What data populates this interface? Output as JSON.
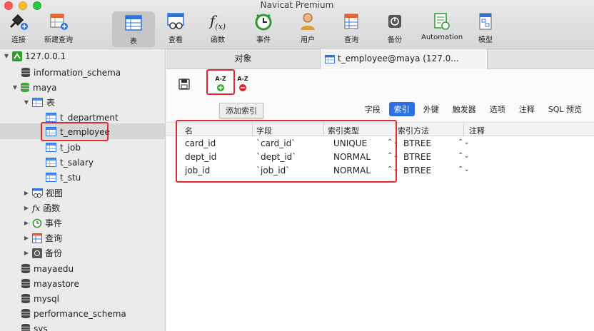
{
  "window": {
    "title": "Navicat Premium"
  },
  "toolbar": {
    "items": [
      {
        "label": "连接",
        "icon": "plug-icon"
      },
      {
        "label": "新建查询",
        "icon": "new-query-icon"
      },
      {
        "label": "表",
        "icon": "table-icon"
      },
      {
        "label": "查看",
        "icon": "view-icon"
      },
      {
        "label": "函数",
        "icon": "function-icon"
      },
      {
        "label": "事件",
        "icon": "event-clock-icon"
      },
      {
        "label": "用户",
        "icon": "user-icon"
      },
      {
        "label": "查询",
        "icon": "query-icon"
      },
      {
        "label": "备份",
        "icon": "backup-icon"
      },
      {
        "label": "Automation",
        "icon": "automation-icon"
      },
      {
        "label": "模型",
        "icon": "model-icon"
      }
    ],
    "active": "表"
  },
  "sidebar": {
    "connection": "127.0.0.1",
    "databases": [
      "information_schema",
      "maya",
      "mayaedu",
      "mayastore",
      "mysql",
      "performance_schema",
      "sys"
    ],
    "maya_children": {
      "tables_label": "表",
      "tables": [
        "t_department",
        "t_employee",
        "t_job",
        "t_salary",
        "t_stu"
      ],
      "selected_table": "t_employee",
      "groups": [
        "视图",
        "函数",
        "事件",
        "查询",
        "备份"
      ]
    }
  },
  "tabs": {
    "objects": "对象",
    "editor": "t_employee@maya (127.0..."
  },
  "editor_toolbar": {
    "save_icon": "save-icon",
    "add_index_glyph": "A-Z",
    "remove_index_glyph": "A-Z",
    "tooltip": "添加索引"
  },
  "subtabs": {
    "items": [
      "字段",
      "索引",
      "外键",
      "触发器",
      "选项",
      "注释",
      "SQL 预览"
    ],
    "active": "索引"
  },
  "index_table": {
    "columns": [
      "名",
      "字段",
      "索引类型",
      "索引方法",
      "注释"
    ],
    "rows": [
      {
        "name": "card_id",
        "field": "`card_id`",
        "type": "UNIQUE",
        "method": "BTREE",
        "comment": ""
      },
      {
        "name": "dept_id",
        "field": "`dept_id`",
        "type": "NORMAL",
        "method": "BTREE",
        "comment": ""
      },
      {
        "name": "job_id",
        "field": "`job_id`",
        "type": "NORMAL",
        "method": "BTREE",
        "comment": ""
      }
    ]
  },
  "colors": {
    "accent": "#2d6fe0",
    "highlight": "#e0282e",
    "add": "#3aa832",
    "remove": "#e0282e"
  }
}
